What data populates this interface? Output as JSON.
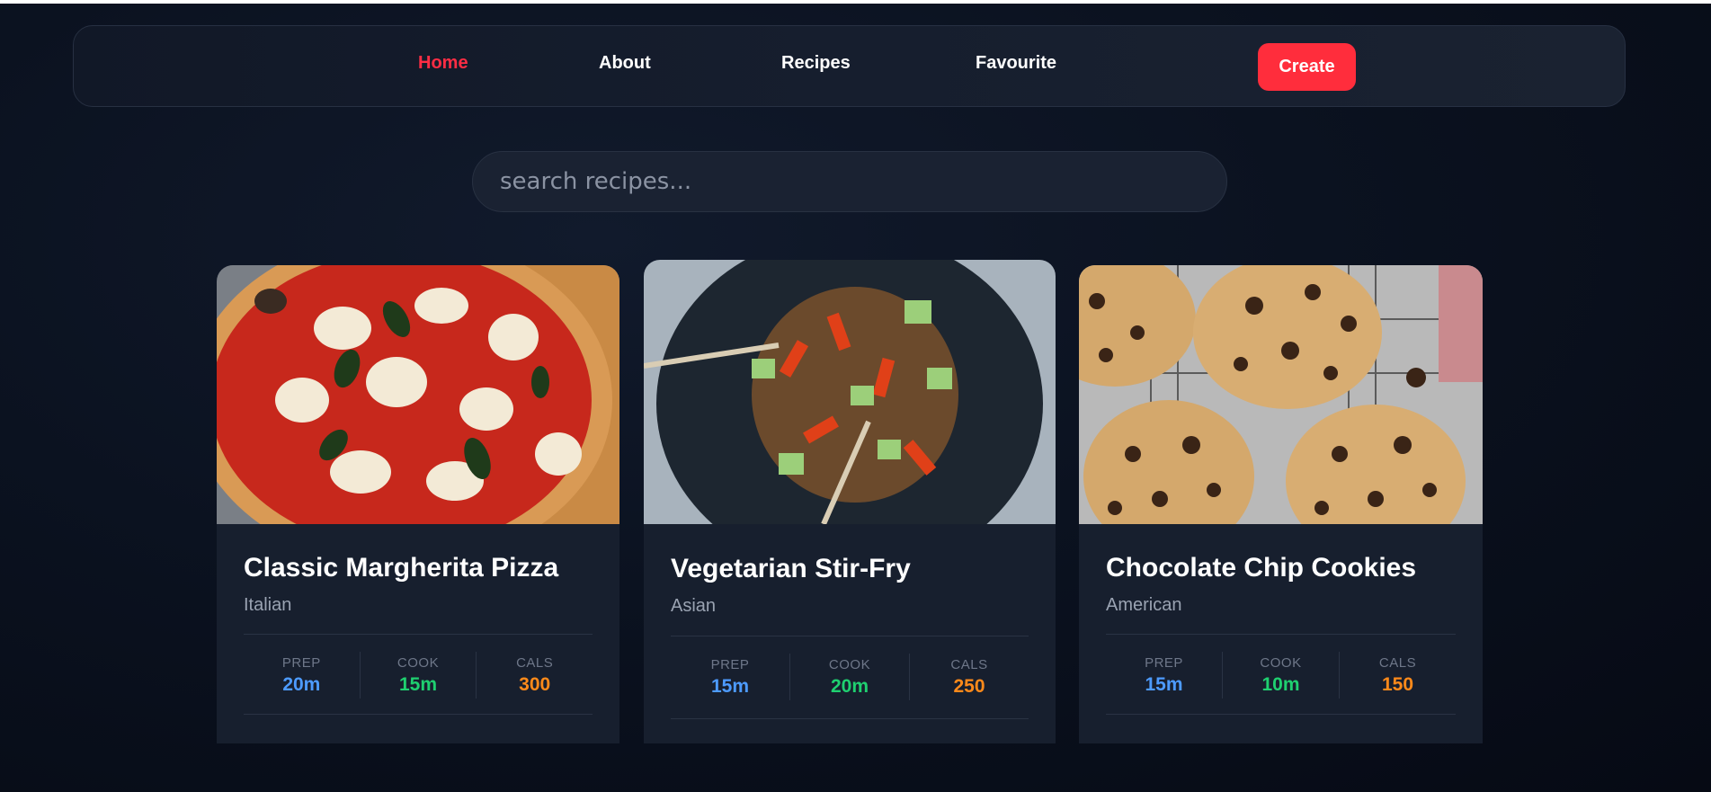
{
  "nav": {
    "links": [
      {
        "label": "Home",
        "active": true
      },
      {
        "label": "About",
        "active": false
      },
      {
        "label": "Recipes",
        "active": false
      },
      {
        "label": "Favourite",
        "active": false
      }
    ],
    "create_label": "Create"
  },
  "search": {
    "placeholder": "search recipes..."
  },
  "colors": {
    "accent": "#ff2d3c",
    "prep": "#4d9bff",
    "cook": "#1fd070",
    "cals": "#ff8a1a"
  },
  "recipes": [
    {
      "title": "Classic Margherita Pizza",
      "cuisine": "Italian",
      "image": "margherita-pizza",
      "stats": {
        "prep_label": "PREP",
        "prep": "20m",
        "cook_label": "COOK",
        "cook": "15m",
        "cals_label": "CALS",
        "cals": "300"
      }
    },
    {
      "title": "Vegetarian Stir-Fry",
      "cuisine": "Asian",
      "image": "vegetable-stir-fry",
      "stats": {
        "prep_label": "PREP",
        "prep": "15m",
        "cook_label": "COOK",
        "cook": "20m",
        "cals_label": "CALS",
        "cals": "250"
      }
    },
    {
      "title": "Chocolate Chip Cookies",
      "cuisine": "American",
      "image": "chocolate-chip-cookies",
      "stats": {
        "prep_label": "PREP",
        "prep": "15m",
        "cook_label": "COOK",
        "cook": "10m",
        "cals_label": "CALS",
        "cals": "150"
      }
    }
  ]
}
